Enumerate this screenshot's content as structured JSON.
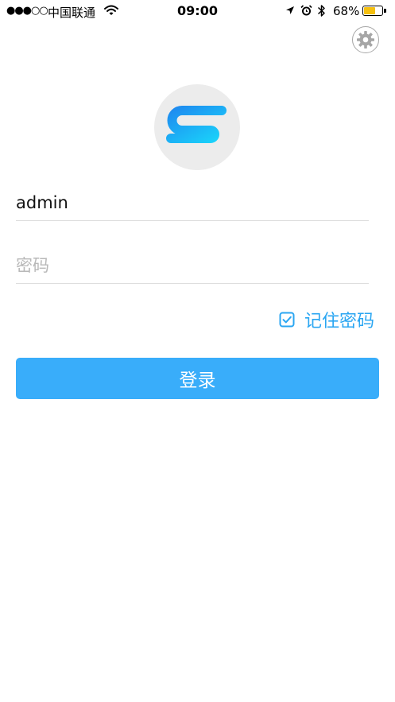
{
  "status_bar": {
    "signal": "●●●○○",
    "carrier": "中国联通",
    "time": "09:00",
    "battery_percent": "68%",
    "battery_level": 0.68,
    "icons": [
      "wifi-icon",
      "location-arrow-icon",
      "alarm-clock-icon",
      "bluetooth-icon",
      "battery-icon"
    ]
  },
  "header": {
    "settings_icon": "gear-icon"
  },
  "logo": {
    "icon": "s-logo-icon",
    "colors": {
      "gradient_start": "#1e8cf0",
      "gradient_end": "#1ad2fa",
      "background": "#ececec"
    }
  },
  "login_form": {
    "username": {
      "value": "admin",
      "placeholder": ""
    },
    "password": {
      "value": "",
      "placeholder": "密码"
    },
    "remember_password": {
      "label": "记住密码",
      "checked": true
    },
    "submit_label": "登录"
  },
  "colors": {
    "accent": "#39adfa",
    "remember_text": "#2aa6f2",
    "battery_fill": "#f5c010"
  }
}
